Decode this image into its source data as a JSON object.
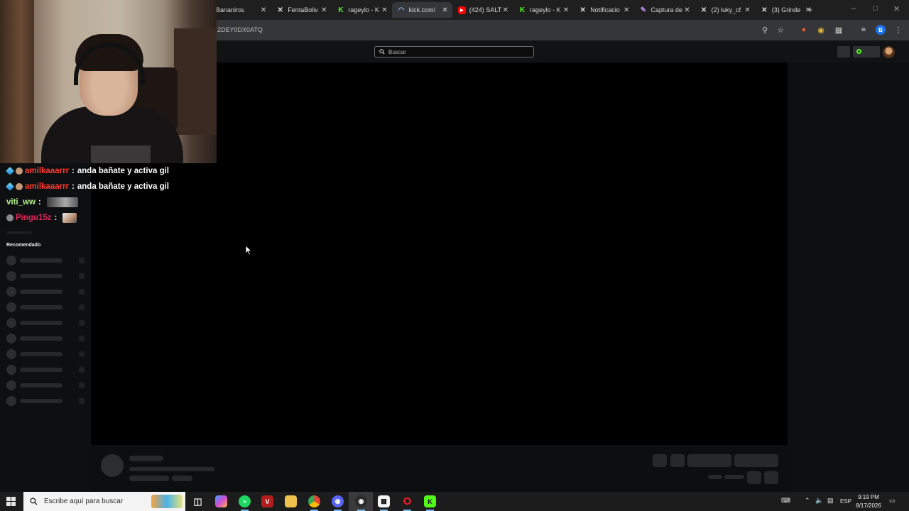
{
  "browser": {
    "tabs": [
      {
        "label": "Bananirou",
        "icon": "x-logo-icon",
        "active": false
      },
      {
        "label": "FentaBoliv",
        "icon": "x-logo-icon",
        "active": false
      },
      {
        "label": "rageylo - K",
        "icon": "kick-logo-icon",
        "active": false
      },
      {
        "label": "kick.com/",
        "icon": "loading-icon",
        "active": true
      },
      {
        "label": "(424) SALT",
        "icon": "youtube-icon",
        "active": false
      },
      {
        "label": "rageylo - K",
        "icon": "kick-logo-icon",
        "active": false
      },
      {
        "label": "Notificacio",
        "icon": "x-logo-icon",
        "active": false
      },
      {
        "label": "Captura de",
        "icon": "pen-icon",
        "active": false
      },
      {
        "label": "(2) luky_cf",
        "icon": "x-logo-icon",
        "active": false
      },
      {
        "label": "(3) Grinde",
        "icon": "x-logo-icon",
        "active": false
      }
    ],
    "new_tab_symbol": "+",
    "url": "2DEY0DX0ATQ",
    "profile_initial": "B"
  },
  "site": {
    "search_placeholder": "Buscar",
    "sidebar_section_title": "Recomendado",
    "accent_color": "#53fc18"
  },
  "chat": [
    {
      "user": "amilkaaarrr",
      "user_color": "#ff3b2f",
      "separator": ":",
      "message": "anda bañate y activa gil",
      "badge": "cube"
    },
    {
      "user": "amilkaaarrr",
      "user_color": "#ff3b2f",
      "separator": ":",
      "message": "anda bañate y activa gil",
      "badge": "cube"
    },
    {
      "user": "viti_ww",
      "user_color": "#b6f38a",
      "separator": ":",
      "message": "",
      "badge": "none"
    },
    {
      "user": "Pingu15z",
      "user_color": "#e0245e",
      "separator": ":",
      "message": "",
      "badge": "round"
    }
  ],
  "taskbar": {
    "search_placeholder": "Escribe aquí para buscar",
    "language": "ESP",
    "time": "9:19 PM",
    "date": "8/17/2026"
  }
}
